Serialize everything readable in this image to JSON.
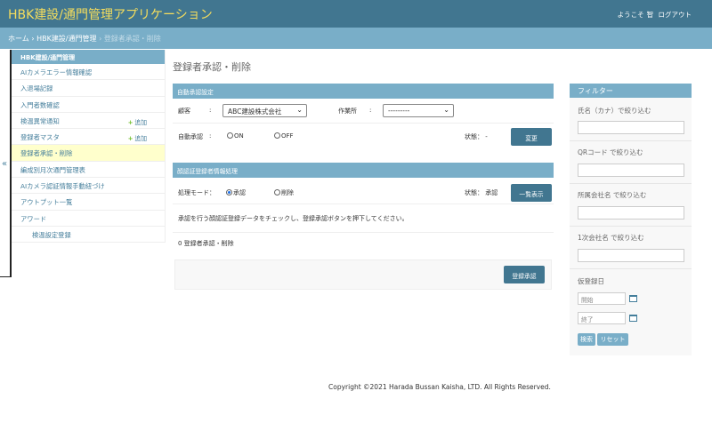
{
  "header": {
    "app_title": "HBK建設/通門管理アプリケーション",
    "welcome": "ようこそ",
    "user_name": "智",
    "logout": "ログアウト"
  },
  "breadcrumb": {
    "home": "ホーム",
    "separator": "›",
    "app": "HBK建設/通門管理",
    "current": "登録者承認・削除"
  },
  "sidebar": {
    "heading": "HBK建設/通門管理",
    "collapse_icon": "«",
    "items": [
      {
        "label": "AIカメラエラー情報確認",
        "add": ""
      },
      {
        "label": "入退場記録",
        "add": ""
      },
      {
        "label": "入門者数確認",
        "add": ""
      },
      {
        "label": "検温異常通知",
        "add": "追加"
      },
      {
        "label": "登録者マスタ",
        "add": "追加"
      },
      {
        "label": "登録者承認・削除",
        "add": "",
        "active": true
      },
      {
        "label": "編成別月次通門管理表",
        "add": ""
      },
      {
        "label": "AIカメラ認証情報手動紐づけ",
        "add": ""
      },
      {
        "label": "アウトプット一覧",
        "add": ""
      },
      {
        "label": "アワード",
        "add": ""
      },
      {
        "label": "検温設定登録",
        "add": "",
        "sub": true
      }
    ]
  },
  "page_title": "登録者承認・削除",
  "auto_approval": {
    "heading": "自動承認設定",
    "customer_label": "顧客",
    "colon": ":",
    "customer_value": "ABC建設株式会社",
    "site_label": "作業所",
    "site_value": "---------",
    "auto_label": "自動承認",
    "on_label": "ON",
    "off_label": "OFF",
    "status_label": "状態：",
    "status_value": "-",
    "change_button": "変更"
  },
  "face_processing": {
    "heading": "顔認証登録者情報処理",
    "mode_label": "処理モード：",
    "approve_label": "承認",
    "delete_label": "削除",
    "status_label": "状態：",
    "status_value": "承認",
    "list_button": "一覧表示",
    "instruction": "承認を行う顔認証登録データをチェックし、登録承認ボタンを押下してください。",
    "count_text": "0 登録者承認・削除",
    "register_button": "登録承認"
  },
  "filter": {
    "heading": "フィルター",
    "kana_label": "氏名（カナ）で絞り込む",
    "qr_label": "QRコード で絞り込む",
    "company_label": "所属会社名 で絞り込む",
    "primary_label": "1次会社名 で絞り込む",
    "date_label": "仮登録日",
    "start_placeholder": "開始",
    "end_placeholder": "終了",
    "search_button": "検索",
    "reset_button": "リセット"
  },
  "footer": "Copyright ©2021 Harada Bussan Kaisha, LTD. All Rights Reserved.",
  "colors": {
    "header": "#417690",
    "breadcrumb": "#79aec8",
    "title_yellow": "#f5dd5d",
    "active_row": "#ffffcc",
    "add_plus": "#70bf2b"
  }
}
